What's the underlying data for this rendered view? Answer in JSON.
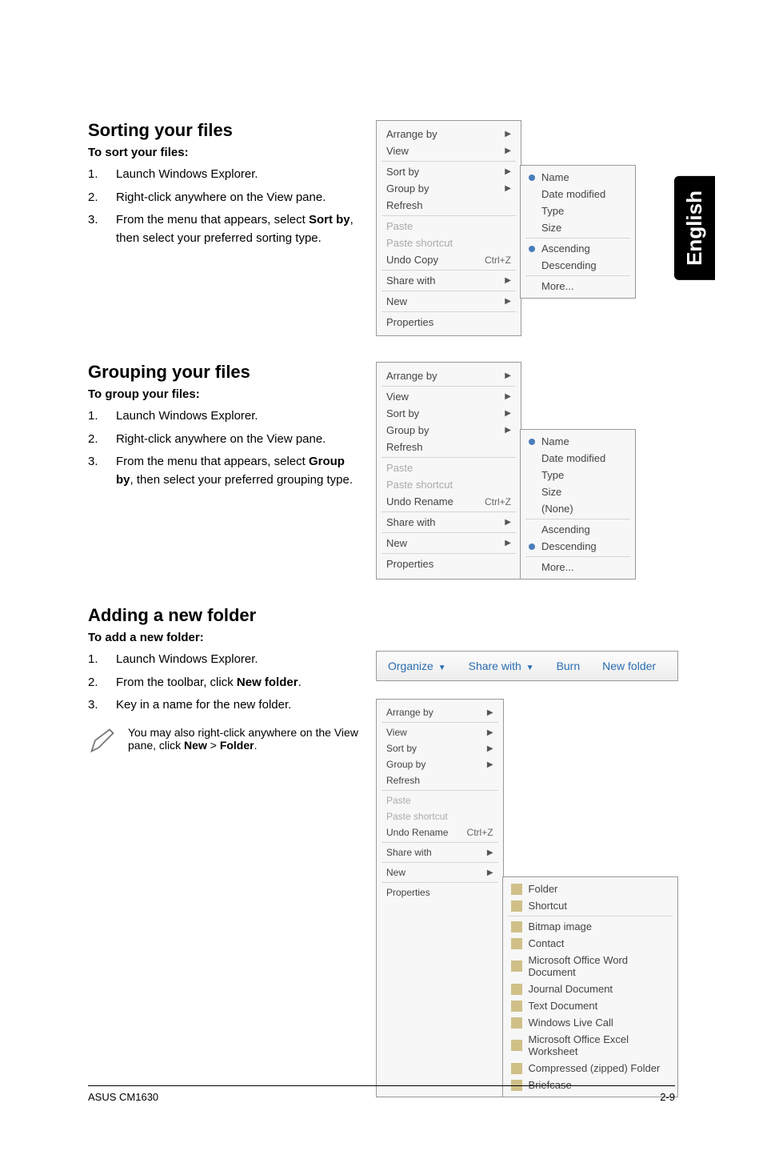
{
  "sideTab": "English",
  "section1": {
    "heading": "Sorting your files",
    "subhead": "To sort your files:",
    "steps": [
      {
        "n": "1.",
        "t": "Launch Windows Explorer."
      },
      {
        "n": "2.",
        "t": "Right-click anywhere on the View pane."
      },
      {
        "n": "3.",
        "t": "From the menu that appears, select Sort by, then select your preferred sorting type."
      }
    ]
  },
  "menu1": {
    "items": [
      {
        "label": "Arrange by",
        "arrow": true
      },
      {
        "label": "View",
        "arrow": true,
        "hr": true
      },
      {
        "label": "Sort by",
        "arrow": true
      },
      {
        "label": "Group by",
        "arrow": true
      },
      {
        "label": "Refresh",
        "hr": true
      },
      {
        "label": "Paste",
        "disabled": true
      },
      {
        "label": "Paste shortcut",
        "disabled": true
      },
      {
        "label": "Undo Copy",
        "shortcut": "Ctrl+Z",
        "hr": true
      },
      {
        "label": "Share with",
        "arrow": true,
        "hr": true
      },
      {
        "label": "New",
        "arrow": true,
        "hr": true
      },
      {
        "label": "Properties"
      }
    ],
    "submenu": [
      {
        "dot": true,
        "label": "Name"
      },
      {
        "label": "Date modified"
      },
      {
        "label": "Type"
      },
      {
        "label": "Size",
        "hr": true
      },
      {
        "dot": true,
        "label": "Ascending"
      },
      {
        "label": "Descending",
        "hr": true
      },
      {
        "label": "More..."
      }
    ]
  },
  "section2": {
    "heading": "Grouping your files",
    "subhead": "To group your files:",
    "steps": [
      {
        "n": "1.",
        "t": "Launch Windows Explorer."
      },
      {
        "n": "2.",
        "t": "Right-click anywhere on the View pane."
      },
      {
        "n": "3.",
        "t": "From the menu that appears, select Group by, then select your preferred grouping type."
      }
    ]
  },
  "menu2": {
    "items": [
      {
        "label": "Arrange by",
        "arrow": true,
        "hr": true
      },
      {
        "label": "View",
        "arrow": true
      },
      {
        "label": "Sort by",
        "arrow": true
      },
      {
        "label": "Group by",
        "arrow": true
      },
      {
        "label": "Refresh",
        "hr": true
      },
      {
        "label": "Paste",
        "disabled": true
      },
      {
        "label": "Paste shortcut",
        "disabled": true
      },
      {
        "label": "Undo Rename",
        "shortcut": "Ctrl+Z",
        "hr": true
      },
      {
        "label": "Share with",
        "arrow": true,
        "hr": true
      },
      {
        "label": "New",
        "arrow": true,
        "hr": true
      },
      {
        "label": "Properties"
      }
    ],
    "submenu": [
      {
        "dot": true,
        "label": "Name"
      },
      {
        "label": "Date modified"
      },
      {
        "label": "Type"
      },
      {
        "label": "Size"
      },
      {
        "label": "(None)",
        "hr": true
      },
      {
        "label": "Ascending"
      },
      {
        "dot": true,
        "label": "Descending",
        "hr": true
      },
      {
        "label": "More..."
      }
    ]
  },
  "section3": {
    "heading": "Adding a new folder",
    "subhead": "To add a new folder:",
    "steps": [
      {
        "n": "1.",
        "t": "Launch Windows Explorer."
      },
      {
        "n": "2.",
        "t": "From the toolbar, click New folder."
      },
      {
        "n": "3.",
        "t": "Key in a name for the new folder."
      }
    ],
    "note": "You may also right-click anywhere on the View pane, click New > Folder."
  },
  "toolbar": {
    "organize": "Organize",
    "sharewith": "Share with",
    "burn": "Burn",
    "newfolder": "New folder"
  },
  "menu3": {
    "items": [
      {
        "label": "Arrange by",
        "arrow": true,
        "hr": true
      },
      {
        "label": "View",
        "arrow": true
      },
      {
        "label": "Sort by",
        "arrow": true
      },
      {
        "label": "Group by",
        "arrow": true
      },
      {
        "label": "Refresh",
        "hr": true
      },
      {
        "label": "Paste",
        "disabled": true
      },
      {
        "label": "Paste shortcut",
        "disabled": true
      },
      {
        "label": "Undo Rename",
        "shortcut": "Ctrl+Z",
        "hr": true
      },
      {
        "label": "Share with",
        "arrow": true,
        "hr": true
      },
      {
        "label": "New",
        "arrow": true,
        "hr": true
      },
      {
        "label": "Properties"
      }
    ],
    "submenu": [
      {
        "icon": true,
        "label": "Folder"
      },
      {
        "icon": true,
        "label": "Shortcut",
        "hr": true
      },
      {
        "icon": true,
        "label": "Bitmap image"
      },
      {
        "icon": true,
        "label": "Contact"
      },
      {
        "icon": true,
        "label": "Microsoft Office Word Document"
      },
      {
        "icon": true,
        "label": "Journal Document"
      },
      {
        "icon": true,
        "label": "Text Document"
      },
      {
        "icon": true,
        "label": "Windows Live Call"
      },
      {
        "icon": true,
        "label": "Microsoft Office Excel Worksheet"
      },
      {
        "icon": true,
        "label": "Compressed (zipped) Folder"
      },
      {
        "icon": true,
        "label": "Briefcase"
      }
    ]
  },
  "footer": {
    "left": "ASUS CM1630",
    "right": "2-9"
  }
}
